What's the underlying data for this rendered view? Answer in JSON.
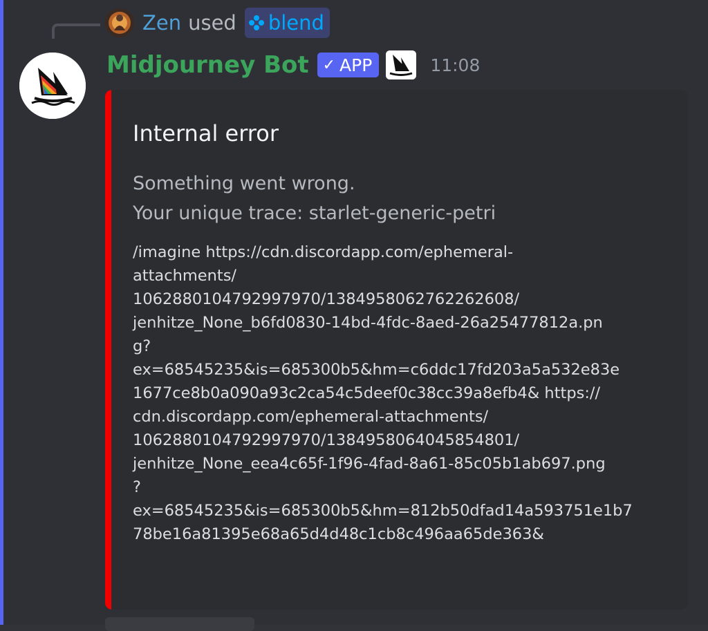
{
  "interaction": {
    "user": "Zen",
    "verb": "used",
    "command": "blend"
  },
  "message": {
    "author": "Midjourney Bot",
    "app_badge": "APP",
    "timestamp": "11:08"
  },
  "embed": {
    "color": "#f20000",
    "title": "Internal error",
    "description_lines": [
      "Something went wrong.",
      "Your unique trace: starlet-generic-petri"
    ],
    "command_lines": [
      "/imagine https://cdn.discordapp.com/ephemeral-",
      "attachments/",
      "1062880104792997970/1384958062762262608/",
      "jenhitze_None_b6fd0830-14bd-4fdc-8aed-26a25477812a.pn",
      "g?",
      "ex=68545235&is=685300b5&hm=c6ddc17fd203a5a532e83e",
      "1677ce8b0a090a93c2ca54c5deef0c38cc39a8efb4& https://",
      "cdn.discordapp.com/ephemeral-attachments/",
      "1062880104792997970/1384958064045854801/",
      "jenhitze_None_eea4c65f-1f96-4fad-8a61-85c05b1ab697.png",
      "?",
      "ex=68545235&is=685300b5&hm=812b50dfad14a593751e1b7",
      "78be16a81395e68a65d4d48c1cb8c496aa65de363&"
    ]
  },
  "icons": {
    "command_icon": "blend-command-icon",
    "avatar": "midjourney-boat-logo"
  },
  "colors": {
    "username_reply": "#4f9fd8",
    "bot_name": "#3ba55c",
    "command_link": "#00a8fc",
    "app_badge": "#5865f2"
  }
}
